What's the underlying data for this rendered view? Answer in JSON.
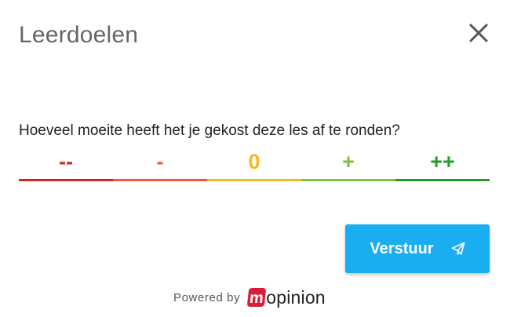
{
  "dialog": {
    "title": "Leerdoelen",
    "close_icon": "close-icon"
  },
  "question": {
    "text": "Hoeveel moeite heeft het je gekost deze les af te ronden?",
    "options": [
      {
        "label": "--",
        "color": "#e02020"
      },
      {
        "label": "-",
        "color": "#f0583a"
      },
      {
        "label": "0",
        "color": "#f6b91a"
      },
      {
        "label": "+",
        "color": "#7cc242"
      },
      {
        "label": "++",
        "color": "#2a9a2a"
      }
    ]
  },
  "submit": {
    "label": "Verstuur",
    "icon": "paper-plane-icon",
    "color": "#1aaef0"
  },
  "footer": {
    "powered_by": "Powered by",
    "brand_initial": "m",
    "brand_rest": "opinion",
    "brand_color": "#d81e3a"
  }
}
